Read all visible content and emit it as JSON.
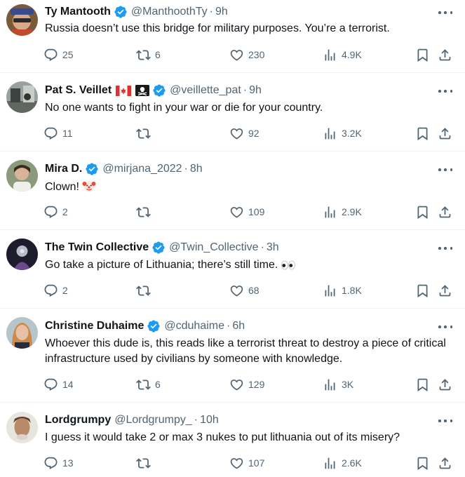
{
  "tweets": [
    {
      "name": "Ty Mantooth",
      "handle": "@ManthoothTy",
      "time": "9h",
      "text": "Russia doesn’t use this bridge for military purposes. You’re a terrorist.",
      "replies": "25",
      "retweets": "6",
      "likes": "230",
      "views": "4.9K"
    },
    {
      "name": "Pat S. Veillet",
      "handle": "@veillette_pat",
      "time": "9h",
      "text": "No one wants to fight in your war or die for your country.",
      "replies": "11",
      "retweets": "",
      "likes": "92",
      "views": "3.2K"
    },
    {
      "name": "Mira D.",
      "handle": "@mirjana_2022",
      "time": "8h",
      "text": "Clown!",
      "replies": "2",
      "retweets": "",
      "likes": "109",
      "views": "2.9K"
    },
    {
      "name": "The Twin Collective",
      "handle": "@Twin_Collective",
      "time": "3h",
      "text": "Go take a picture of Lithuania; there’s still time.",
      "replies": "2",
      "retweets": "",
      "likes": "68",
      "views": "1.8K"
    },
    {
      "name": "Christine Duhaime",
      "handle": "@cduhaime",
      "time": "6h",
      "text": "Whoever this dude is, this reads like a terrorist threat to destroy a piece  of critical infrastructure used by civilians by someone with knowledge.",
      "replies": "14",
      "retweets": "6",
      "likes": "129",
      "views": "3K"
    },
    {
      "name": "Lordgrumpy",
      "handle": "@Lordgrumpy_",
      "time": "10h",
      "text": "I guess it would take 2 or max 3 nukes to put lithuania out of its misery?",
      "replies": "13",
      "retweets": "",
      "likes": "107",
      "views": "2.6K"
    }
  ],
  "colors": {
    "text": "#0f1419",
    "secondary": "#536471",
    "verified": "#1d9bf0",
    "divider": "#eff3f4"
  }
}
